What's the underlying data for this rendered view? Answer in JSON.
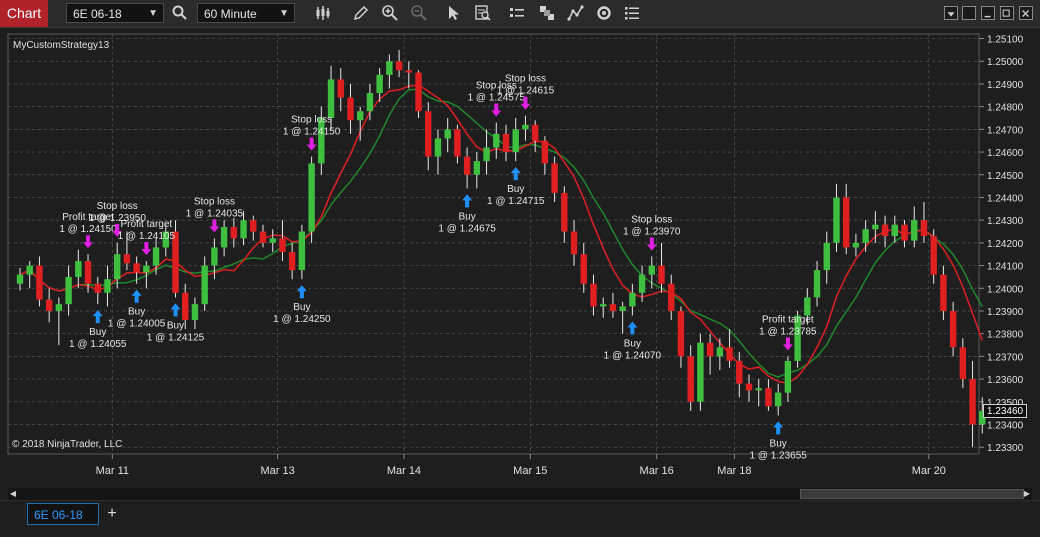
{
  "toolbar": {
    "chart_label": "Chart",
    "instrument": "6E 06-18",
    "interval": "60 Minute",
    "icons": [
      "search-icon",
      "bars-type-icon",
      "draw-tool-icon",
      "zoom-in-icon",
      "zoom-out-icon",
      "pointer-icon",
      "data-box-icon",
      "instrument-list-icon",
      "templates-icon",
      "strategies-icon",
      "refresh-icon",
      "properties-icon"
    ]
  },
  "chart": {
    "strategy": "MyCustomStrategy13",
    "copyright": "© 2018 NinjaTrader, LLC",
    "last_price": "1.23460",
    "colors": {
      "up": "#3fbf3f",
      "down": "#e02020",
      "fast_ma": "#e02020",
      "slow_ma": "#1f8a2a",
      "buy": "#1e90ff",
      "exit": "#e020e0",
      "grid": "#555555",
      "background": "#1e1e1e"
    }
  },
  "chart_data": {
    "type": "candlestick",
    "y_axis_labels": [
      "1.25100",
      "1.25000",
      "1.24900",
      "1.24800",
      "1.24700",
      "1.24600",
      "1.24500",
      "1.24400",
      "1.24300",
      "1.24200",
      "1.24100",
      "1.24000",
      "1.23900",
      "1.23800",
      "1.23700",
      "1.23600",
      "1.23500",
      "1.23400",
      "1.23300"
    ],
    "ylim": [
      1.2327,
      1.2512
    ],
    "x_axis_labels": [
      {
        "label": "Mar 11",
        "bar": 10
      },
      {
        "label": "Mar 13",
        "bar": 27
      },
      {
        "label": "Mar 14",
        "bar": 40
      },
      {
        "label": "Mar 15",
        "bar": 53
      },
      {
        "label": "Mar 16",
        "bar": 66
      },
      {
        "label": "Mar 18",
        "bar": 74
      },
      {
        "label": "Mar 20",
        "bar": 94
      }
    ],
    "candles": [
      [
        1.2402,
        1.2409,
        1.2399,
        1.2406
      ],
      [
        1.2406,
        1.2412,
        1.24,
        1.241
      ],
      [
        1.241,
        1.2414,
        1.2392,
        1.2395
      ],
      [
        1.2395,
        1.24,
        1.2385,
        1.239
      ],
      [
        1.239,
        1.2396,
        1.2375,
        1.2393
      ],
      [
        1.2393,
        1.241,
        1.2388,
        1.2405
      ],
      [
        1.2405,
        1.2417,
        1.24,
        1.2412
      ],
      [
        1.2412,
        1.2415,
        1.2398,
        1.2402
      ],
      [
        1.2402,
        1.2405,
        1.2393,
        1.2398
      ],
      [
        1.2398,
        1.241,
        1.2392,
        1.2404
      ],
      [
        1.2404,
        1.242,
        1.24,
        1.2415
      ],
      [
        1.2415,
        1.2425,
        1.2408,
        1.2411
      ],
      [
        1.2411,
        1.2414,
        1.2402,
        1.2407
      ],
      [
        1.2407,
        1.2412,
        1.24,
        1.241
      ],
      [
        1.241,
        1.2422,
        1.2406,
        1.2418
      ],
      [
        1.2418,
        1.2428,
        1.2414,
        1.2425
      ],
      [
        1.2425,
        1.243,
        1.2396,
        1.2398
      ],
      [
        1.2398,
        1.2402,
        1.2382,
        1.2386
      ],
      [
        1.2386,
        1.2396,
        1.2382,
        1.2393
      ],
      [
        1.2393,
        1.2414,
        1.239,
        1.241
      ],
      [
        1.241,
        1.2422,
        1.2404,
        1.2418
      ],
      [
        1.2418,
        1.243,
        1.2414,
        1.2427
      ],
      [
        1.2427,
        1.2431,
        1.2418,
        1.2422
      ],
      [
        1.2422,
        1.2434,
        1.2419,
        1.243
      ],
      [
        1.243,
        1.2432,
        1.2421,
        1.2425
      ],
      [
        1.2425,
        1.2428,
        1.2418,
        1.242
      ],
      [
        1.242,
        1.2426,
        1.2416,
        1.2422
      ],
      [
        1.2422,
        1.243,
        1.2412,
        1.2416
      ],
      [
        1.2416,
        1.242,
        1.2404,
        1.2408
      ],
      [
        1.2408,
        1.2428,
        1.2404,
        1.2425
      ],
      [
        1.2425,
        1.2458,
        1.242,
        1.2455
      ],
      [
        1.2455,
        1.248,
        1.245,
        1.2475
      ],
      [
        1.2475,
        1.2498,
        1.247,
        1.2492
      ],
      [
        1.2492,
        1.2497,
        1.2478,
        1.2484
      ],
      [
        1.2484,
        1.249,
        1.2468,
        1.2474
      ],
      [
        1.2474,
        1.248,
        1.2465,
        1.2478
      ],
      [
        1.2478,
        1.249,
        1.2474,
        1.2486
      ],
      [
        1.2486,
        1.2497,
        1.2482,
        1.2494
      ],
      [
        1.2494,
        1.2503,
        1.2488,
        1.25
      ],
      [
        1.25,
        1.2505,
        1.2493,
        1.2496
      ],
      [
        1.2496,
        1.25,
        1.2488,
        1.2495
      ],
      [
        1.2495,
        1.2496,
        1.2475,
        1.2478
      ],
      [
        1.2478,
        1.2482,
        1.2452,
        1.2458
      ],
      [
        1.2458,
        1.247,
        1.245,
        1.2466
      ],
      [
        1.2466,
        1.2475,
        1.246,
        1.247
      ],
      [
        1.247,
        1.2472,
        1.2455,
        1.2458
      ],
      [
        1.2458,
        1.2462,
        1.2444,
        1.245
      ],
      [
        1.245,
        1.246,
        1.2444,
        1.2456
      ],
      [
        1.2456,
        1.247,
        1.245,
        1.2462
      ],
      [
        1.2462,
        1.2473,
        1.2457,
        1.2468
      ],
      [
        1.2468,
        1.2472,
        1.2456,
        1.246
      ],
      [
        1.246,
        1.2475,
        1.2456,
        1.247
      ],
      [
        1.247,
        1.2476,
        1.2465,
        1.2472
      ],
      [
        1.2472,
        1.2474,
        1.246,
        1.2465
      ],
      [
        1.2465,
        1.2467,
        1.245,
        1.2455
      ],
      [
        1.2455,
        1.2458,
        1.2438,
        1.2442
      ],
      [
        1.2442,
        1.2445,
        1.242,
        1.2425
      ],
      [
        1.2425,
        1.243,
        1.241,
        1.2415
      ],
      [
        1.2415,
        1.242,
        1.2398,
        1.2402
      ],
      [
        1.2402,
        1.2406,
        1.2388,
        1.2392
      ],
      [
        1.2392,
        1.2396,
        1.2387,
        1.2393
      ],
      [
        1.2393,
        1.2398,
        1.2387,
        1.239
      ],
      [
        1.239,
        1.2394,
        1.238,
        1.2392
      ],
      [
        1.2392,
        1.2402,
        1.2388,
        1.2398
      ],
      [
        1.2398,
        1.241,
        1.2394,
        1.2406
      ],
      [
        1.2406,
        1.2414,
        1.24,
        1.241
      ],
      [
        1.241,
        1.242,
        1.2398,
        1.2402
      ],
      [
        1.2402,
        1.2406,
        1.2386,
        1.239
      ],
      [
        1.239,
        1.2392,
        1.2365,
        1.237
      ],
      [
        1.237,
        1.2375,
        1.2346,
        1.235
      ],
      [
        1.235,
        1.238,
        1.2346,
        1.2376
      ],
      [
        1.2376,
        1.238,
        1.2362,
        1.237
      ],
      [
        1.237,
        1.2378,
        1.2364,
        1.2374
      ],
      [
        1.2374,
        1.2382,
        1.2365,
        1.2368
      ],
      [
        1.2368,
        1.2372,
        1.2352,
        1.2358
      ],
      [
        1.2358,
        1.2362,
        1.235,
        1.2355
      ],
      [
        1.2355,
        1.236,
        1.2348,
        1.2356
      ],
      [
        1.2356,
        1.236,
        1.2346,
        1.2348
      ],
      [
        1.2348,
        1.2358,
        1.2344,
        1.2354
      ],
      [
        1.2354,
        1.237,
        1.235,
        1.2368
      ],
      [
        1.2368,
        1.239,
        1.2365,
        1.2388
      ],
      [
        1.2388,
        1.24,
        1.2384,
        1.2396
      ],
      [
        1.2396,
        1.2412,
        1.2392,
        1.2408
      ],
      [
        1.2408,
        1.2425,
        1.2402,
        1.242
      ],
      [
        1.242,
        1.2446,
        1.2416,
        1.244
      ],
      [
        1.244,
        1.2446,
        1.2415,
        1.2418
      ],
      [
        1.2418,
        1.2424,
        1.2414,
        1.242
      ],
      [
        1.242,
        1.243,
        1.2416,
        1.2426
      ],
      [
        1.2426,
        1.2434,
        1.242,
        1.2428
      ],
      [
        1.2428,
        1.2432,
        1.2418,
        1.2423
      ],
      [
        1.2423,
        1.2432,
        1.242,
        1.2428
      ],
      [
        1.2428,
        1.243,
        1.2418,
        1.2421
      ],
      [
        1.2421,
        1.2436,
        1.2418,
        1.243
      ],
      [
        1.243,
        1.2438,
        1.242,
        1.2423
      ],
      [
        1.2423,
        1.2426,
        1.2402,
        1.2406
      ],
      [
        1.2406,
        1.241,
        1.2386,
        1.239
      ],
      [
        1.239,
        1.2394,
        1.237,
        1.2374
      ],
      [
        1.2374,
        1.2378,
        1.2356,
        1.236
      ],
      [
        1.236,
        1.2368,
        1.233,
        1.234
      ],
      [
        1.234,
        1.2352,
        1.2336,
        1.2346
      ]
    ],
    "markers": [
      {
        "type": "buy",
        "bar": 8,
        "text_top": "Buy",
        "text_bot": "1 @ 1.24055"
      },
      {
        "type": "buy",
        "bar": 12,
        "text_top": "Buy",
        "text_bot": "1 @ 1.24005"
      },
      {
        "type": "buy",
        "bar": 16,
        "text_top": "Buy",
        "text_bot": "1 @ 1.24125"
      },
      {
        "type": "buy",
        "bar": 29,
        "text_top": "Buy",
        "text_bot": "1 @ 1.24250"
      },
      {
        "type": "buy",
        "bar": 46,
        "text_top": "Buy",
        "text_bot": "1 @ 1.24675"
      },
      {
        "type": "buy",
        "bar": 51,
        "text_top": "Buy",
        "text_bot": "1 @ 1.24715"
      },
      {
        "type": "buy",
        "bar": 63,
        "text_top": "Buy",
        "text_bot": "1 @ 1.24070"
      },
      {
        "type": "buy",
        "bar": 78,
        "text_top": "Buy",
        "text_bot": "1 @ 1.23655"
      },
      {
        "type": "exit",
        "bar": 7,
        "text_top": "Profit target",
        "text_bot": "1 @ 1.24150"
      },
      {
        "type": "exit",
        "bar": 10,
        "text_top": "Stop loss",
        "text_bot": "1 @ 1.23950"
      },
      {
        "type": "exit",
        "bar": 13,
        "text_top": "Profit target",
        "text_bot": "1 @ 1.24105"
      },
      {
        "type": "exit",
        "bar": 20,
        "text_top": "Stop loss",
        "text_bot": "1 @ 1.24035"
      },
      {
        "type": "exit",
        "bar": 30,
        "text_top": "Stop loss",
        "text_bot": "1 @ 1.24150"
      },
      {
        "type": "exit",
        "bar": 49,
        "text_top": "Stop loss",
        "text_bot": "1 @ 1.24575"
      },
      {
        "type": "exit",
        "bar": 52,
        "text_top": "Stop loss",
        "text_bot": "1 @ 1.24615"
      },
      {
        "type": "exit",
        "bar": 65,
        "text_top": "Stop loss",
        "text_bot": "1 @ 1.23970"
      },
      {
        "type": "exit",
        "bar": 79,
        "text_top": "Profit target",
        "text_bot": "1 @ 1.23785"
      }
    ]
  },
  "tabs": {
    "instrument_tab": "6E 06-18"
  }
}
